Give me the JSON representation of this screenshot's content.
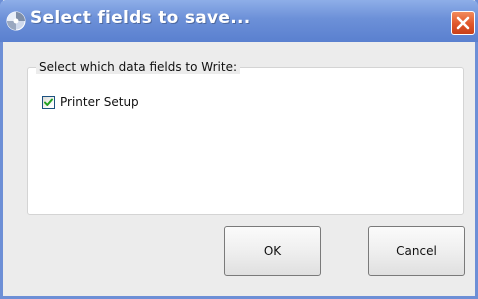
{
  "window": {
    "title": "Select fields to save...",
    "app_icon": "app-logo-icon",
    "close_icon": "close-icon",
    "accent_color": "#6c90d8",
    "close_color": "#e0562a"
  },
  "group": {
    "legend": "Select which data fields to Write:",
    "fields": [
      {
        "label": "Printer Setup",
        "checked": true
      }
    ]
  },
  "buttons": {
    "ok_label": "OK",
    "cancel_label": "Cancel"
  }
}
